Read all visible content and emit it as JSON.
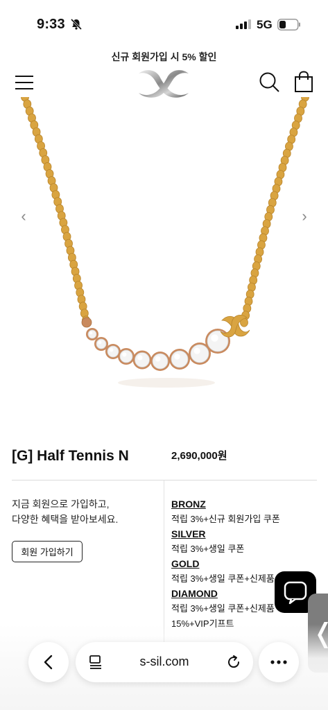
{
  "status_bar": {
    "time": "9:33",
    "network": "5G"
  },
  "header": {
    "promo": "신규 회원가입 시 5% 할인"
  },
  "gallery": {
    "prev_glyph": "‹",
    "next_glyph": "›"
  },
  "product": {
    "name": "[G] Half Tennis N",
    "price": "2,690,000원"
  },
  "membership": {
    "line1": "지금 회원으로 가입하고,",
    "line2": "다양한 혜택을 받아보세요.",
    "join_label": "회원 가입하기",
    "tiers": [
      {
        "name": "BRONZ",
        "benefit": "적립 3%+신규 회원가입 쿠폰"
      },
      {
        "name": "SILVER",
        "benefit": "적립 3%+생일 쿠폰"
      },
      {
        "name": "GOLD",
        "benefit": "적립 3%+생일 쿠폰+신제품"
      },
      {
        "name": "DIAMOND",
        "benefit": "적립 3%+생일 쿠폰+신제품",
        "benefit2": "15%+VIP기프트"
      }
    ]
  },
  "side_tab": {
    "glyph": "❬"
  },
  "browser": {
    "address": "s-sil.com"
  },
  "colors": {
    "gold_chain": "#d9a441",
    "rose_gold": "#c98a5e",
    "chat_bg": "#000000",
    "side_tab_bg": "#7d7d7d"
  }
}
